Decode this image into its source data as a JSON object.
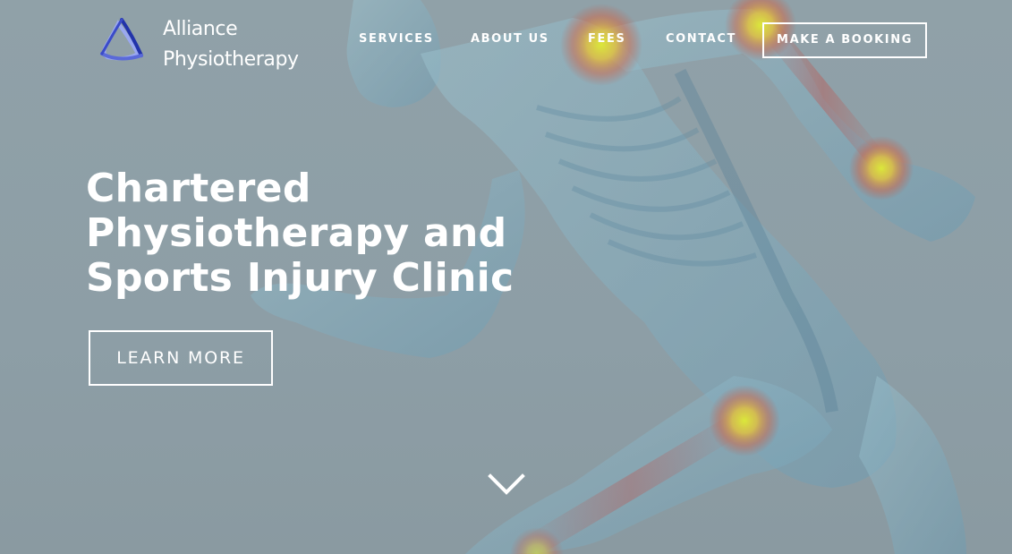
{
  "brand": {
    "name_line1": "Alliance",
    "name_line2": "Physiotherapy",
    "logo_icon": "triangle-swirl-logo"
  },
  "nav": {
    "items": [
      {
        "label": "SERVICES"
      },
      {
        "label": "ABOUT US"
      },
      {
        "label": "FEES"
      },
      {
        "label": "CONTACT"
      }
    ],
    "cta_label": "MAKE A BOOKING"
  },
  "hero": {
    "headline_line1": "Chartered",
    "headline_line2": "Physiotherapy and",
    "headline_line3": "Sports Injury Clinic",
    "button_label": "LEARN MORE",
    "scroll_icon": "chevron-down-icon",
    "background_image": "translucent-running-anatomy-figure"
  },
  "colors": {
    "background": "#8e9fa6",
    "text": "#ffffff",
    "logo_blue": "#2f3fb8",
    "hotspot": "#d7e23a"
  }
}
